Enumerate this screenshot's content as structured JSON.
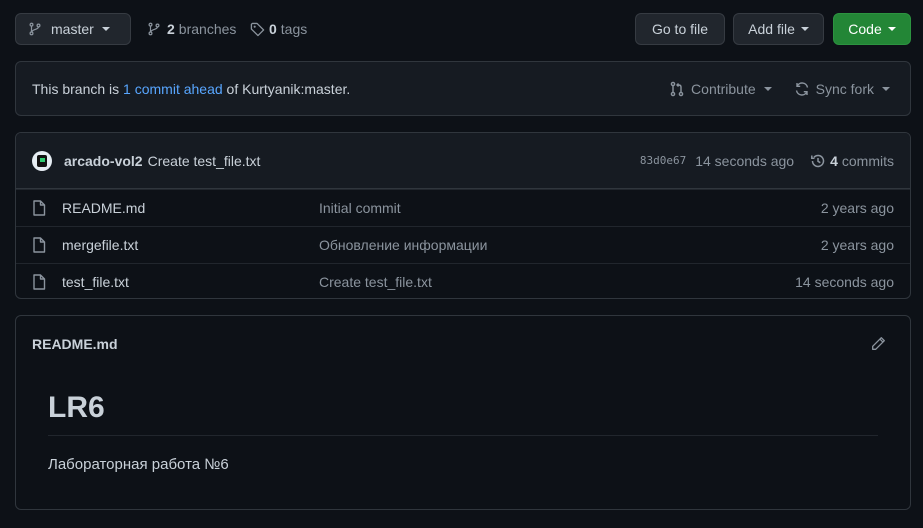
{
  "toolbar": {
    "branch_label": "master",
    "branches_count": "2",
    "branches_label": "branches",
    "tags_count": "0",
    "tags_label": "tags",
    "go_to_file": "Go to file",
    "add_file": "Add file",
    "code": "Code"
  },
  "ahead": {
    "prefix": "This branch is ",
    "link": "1 commit ahead",
    "suffix": " of Kurtyanik:master.",
    "contribute": "Contribute",
    "sync_fork": "Sync fork"
  },
  "latest_commit": {
    "author": "arcado-vol2",
    "message": "Create test_file.txt",
    "sha": "83d0e67",
    "age": "14 seconds ago",
    "commits_count": "4",
    "commits_label": "commits"
  },
  "files": [
    {
      "name": "README.md",
      "message": "Initial commit",
      "age": "2 years ago"
    },
    {
      "name": "mergefile.txt",
      "message": "Обновление информации",
      "age": "2 years ago"
    },
    {
      "name": "test_file.txt",
      "message": "Create test_file.txt",
      "age": "14 seconds ago"
    }
  ],
  "readme": {
    "filename": "README.md",
    "heading": "LR6",
    "paragraph": "Лабораторная работа №6"
  },
  "colors": {
    "background": "#0d1117",
    "panel": "#161b22",
    "border": "#30363d",
    "accent_link": "#58a6ff",
    "primary_button": "#238636",
    "muted_text": "#8b949e"
  },
  "icons": [
    "branch-icon",
    "tag-icon",
    "contribute-icon",
    "sync-icon",
    "history-icon",
    "file-icon",
    "pencil-icon"
  ]
}
